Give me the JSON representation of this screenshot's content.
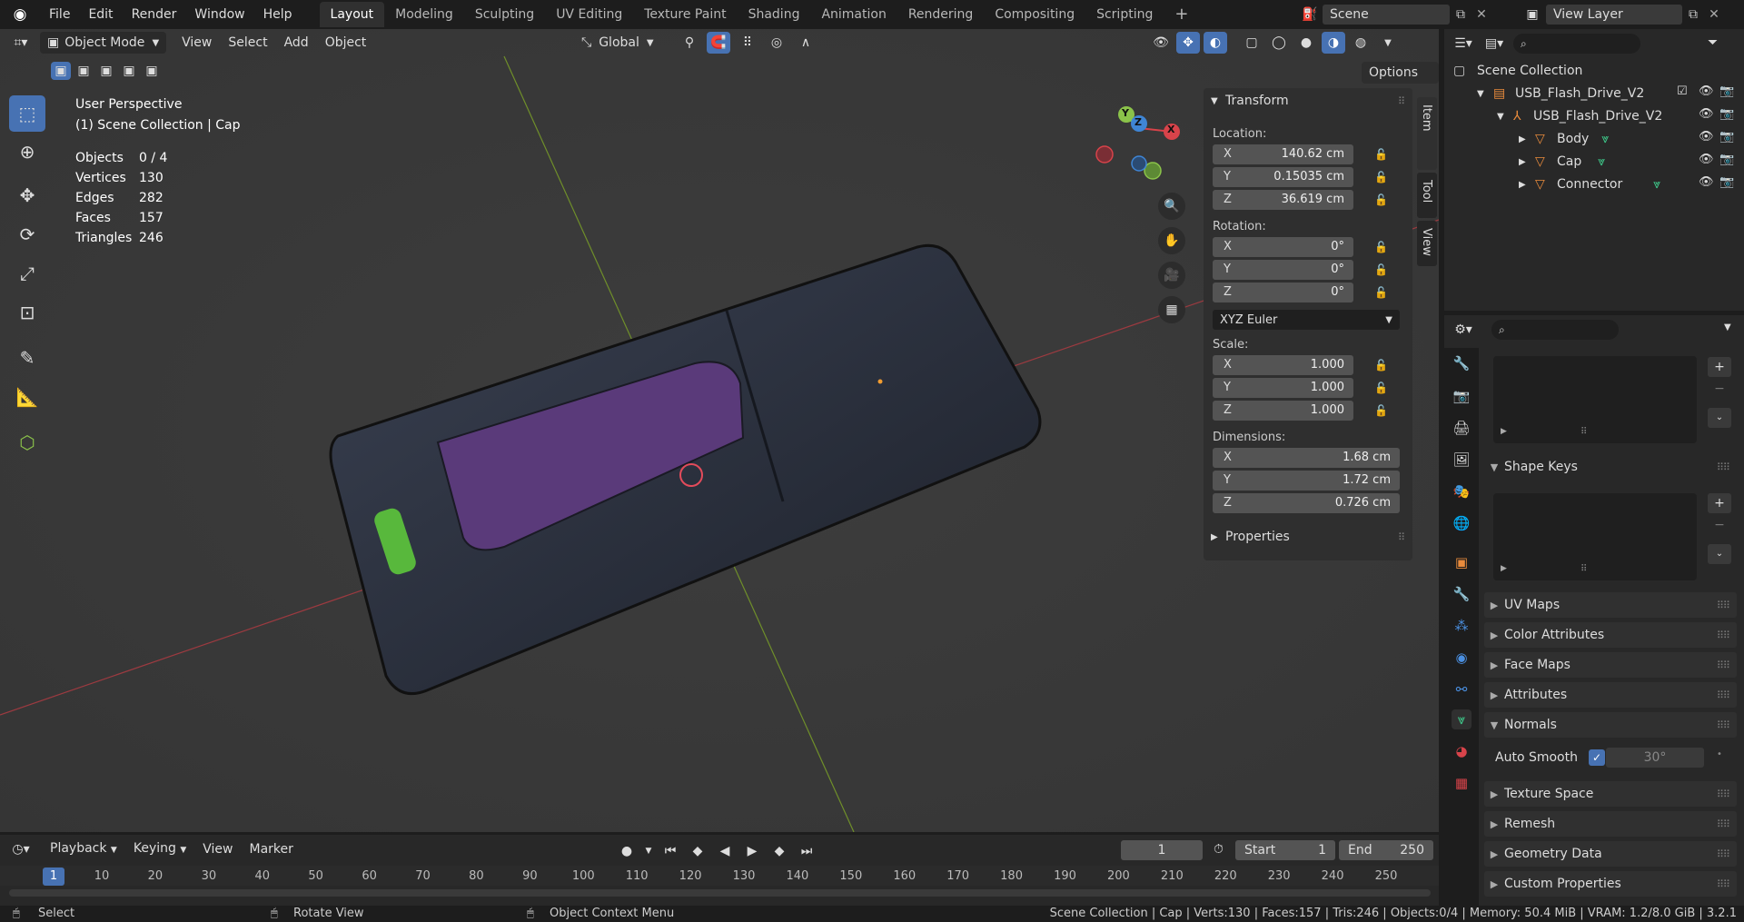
{
  "topbar": {
    "menus": [
      "File",
      "Edit",
      "Render",
      "Window",
      "Help"
    ],
    "workspaces": [
      "Layout",
      "Modeling",
      "Sculpting",
      "UV Editing",
      "Texture Paint",
      "Shading",
      "Animation",
      "Rendering",
      "Compositing",
      "Scripting"
    ],
    "add_tab": "+",
    "scene_name": "Scene",
    "view_layer": "View Layer"
  },
  "viewport": {
    "mode": "Object Mode",
    "menus": [
      "View",
      "Select",
      "Add",
      "Object"
    ],
    "orientation": "Global",
    "options": "Options",
    "perspective": "User Perspective",
    "collection_info": "(1) Scene Collection | Cap",
    "stats": [
      {
        "label": "Objects",
        "value": "0 / 4"
      },
      {
        "label": "Vertices",
        "value": "130"
      },
      {
        "label": "Edges",
        "value": "282"
      },
      {
        "label": "Faces",
        "value": "157"
      },
      {
        "label": "Triangles",
        "value": "246"
      }
    ],
    "gizmo": {
      "x": "X",
      "y": "Y",
      "z": "Z"
    }
  },
  "npanel": {
    "title": "Transform",
    "location_label": "Location:",
    "location": [
      {
        "axis": "X",
        "value": "140.62 cm"
      },
      {
        "axis": "Y",
        "value": "0.15035 cm"
      },
      {
        "axis": "Z",
        "value": "36.619 cm"
      }
    ],
    "rotation_label": "Rotation:",
    "rotation": [
      {
        "axis": "X",
        "value": "0°"
      },
      {
        "axis": "Y",
        "value": "0°"
      },
      {
        "axis": "Z",
        "value": "0°"
      }
    ],
    "rotation_mode": "XYZ Euler",
    "scale_label": "Scale:",
    "scale": [
      {
        "axis": "X",
        "value": "1.000"
      },
      {
        "axis": "Y",
        "value": "1.000"
      },
      {
        "axis": "Z",
        "value": "1.000"
      }
    ],
    "dimensions_label": "Dimensions:",
    "dimensions": [
      {
        "axis": "X",
        "value": "1.68 cm"
      },
      {
        "axis": "Y",
        "value": "1.72 cm"
      },
      {
        "axis": "Z",
        "value": "0.726 cm"
      }
    ],
    "properties": "Properties",
    "tabs": [
      "Item",
      "Tool",
      "View"
    ]
  },
  "outliner": {
    "root": "Scene Collection",
    "items": [
      {
        "name": "USB_Flash_Drive_V2",
        "kind": "collection"
      },
      {
        "name": "USB_Flash_Drive_V2",
        "kind": "empty"
      },
      {
        "name": "Body",
        "kind": "mesh"
      },
      {
        "name": "Cap",
        "kind": "mesh"
      },
      {
        "name": "Connector",
        "kind": "mesh"
      }
    ]
  },
  "properties": {
    "sections": [
      "Shape Keys",
      "UV Maps",
      "Color Attributes",
      "Face Maps",
      "Attributes",
      "Normals",
      "Texture Space",
      "Remesh",
      "Geometry Data",
      "Custom Properties"
    ],
    "auto_smooth_label": "Auto Smooth",
    "auto_smooth_angle": "30°"
  },
  "timeline": {
    "menus": [
      "Playback",
      "Keying",
      "View",
      "Marker"
    ],
    "current_frame": "1",
    "start_label": "Start",
    "start": "1",
    "end_label": "End",
    "end": "250",
    "ticks": [
      "1",
      "10",
      "20",
      "30",
      "40",
      "50",
      "60",
      "70",
      "80",
      "90",
      "100",
      "110",
      "120",
      "130",
      "140",
      "150",
      "160",
      "170",
      "180",
      "190",
      "200",
      "210",
      "220",
      "230",
      "240",
      "250"
    ]
  },
  "statusbar": {
    "select": "Select",
    "rotate": "Rotate View",
    "context": "Object Context Menu",
    "info": "Scene Collection | Cap | Verts:130 | Faces:157 | Tris:246 | Objects:0/4 | Memory: 50.4 MiB | VRAM: 1.2/8.0 GiB | 3.2.1"
  },
  "colors": {
    "accent": "#4772b3",
    "axis_x": "#d8434a",
    "axis_y": "#8bc34a",
    "axis_z": "#3f85d4",
    "mesh_icon": "#e98b3c"
  }
}
